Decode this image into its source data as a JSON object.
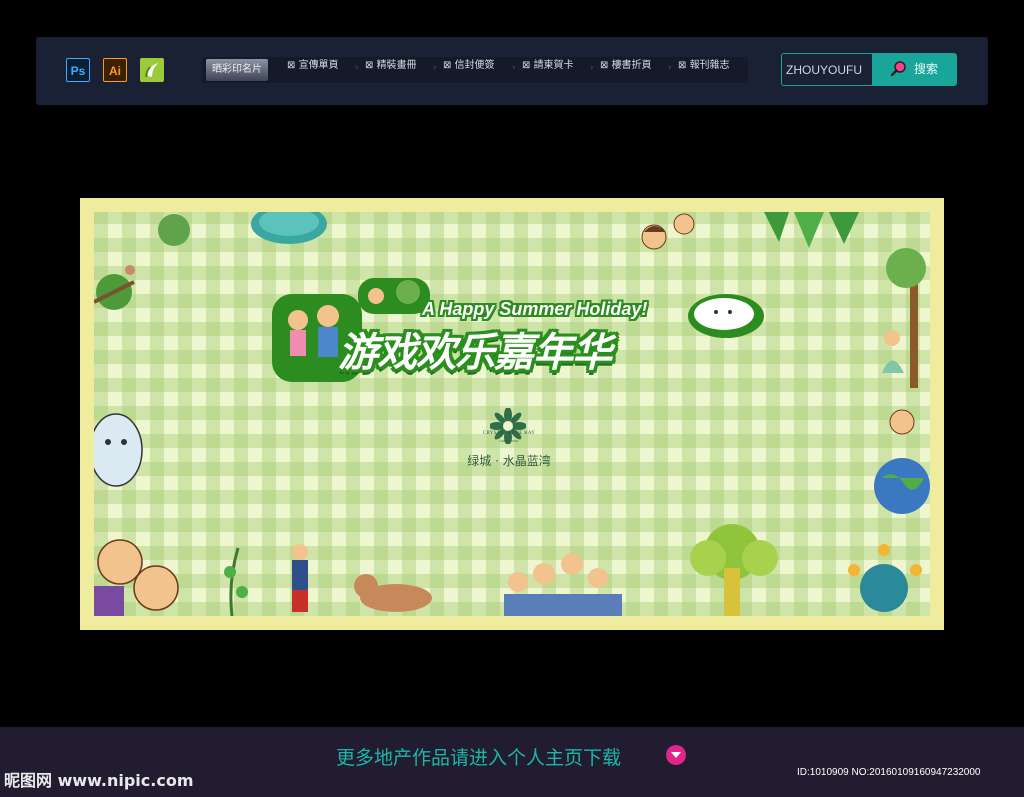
{
  "toolbar": {
    "app_icons": [
      {
        "label": "Ps",
        "icon": "photoshop-icon"
      },
      {
        "label": "Ai",
        "icon": "illustrator-icon"
      },
      {
        "label": "",
        "icon": "coreldraw-icon"
      }
    ],
    "nav": [
      {
        "label": "晒彩印名片",
        "active": true
      },
      {
        "label": "宣傳單頁",
        "active": false
      },
      {
        "label": "精裝畫冊",
        "active": false
      },
      {
        "label": "信封便簽",
        "active": false
      },
      {
        "label": "請柬賀卡",
        "active": false
      },
      {
        "label": "樓書折頁",
        "active": false
      },
      {
        "label": "報刊雜志",
        "active": false
      }
    ],
    "search": {
      "value": "ZHOUYOUFU",
      "button_label": "搜索"
    }
  },
  "board": {
    "subtitle": "A Happy Summer Holiday!",
    "title": "游戏欢乐嘉年华",
    "logo_en": "CRYSTAL BLUE BAY",
    "logo_sub": "GREENTOWN",
    "logo_cn": "绿城 · 水晶蓝湾",
    "colors": {
      "border": "#f0ec9d",
      "check": "#eef6cf",
      "title_outline": "#2a8f1e"
    }
  },
  "footer": {
    "text": "更多地产作品请进入个人主页下载",
    "watermark": "昵图网 www.nipic.com",
    "id_text": "ID:1010909 NO:20160109160947232000"
  }
}
